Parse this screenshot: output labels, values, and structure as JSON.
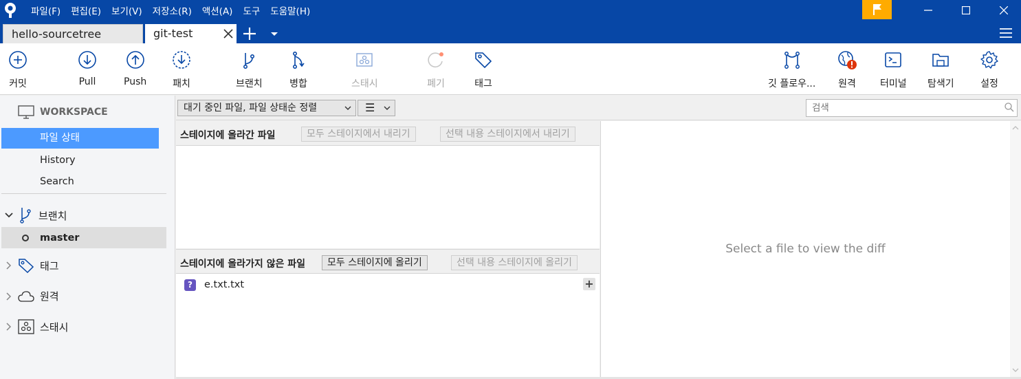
{
  "menu": [
    "파일(F)",
    "편집(E)",
    "보기(V)",
    "저장소(R)",
    "액션(A)",
    "도구",
    "도움말(H)"
  ],
  "tabs": [
    {
      "label": "hello-sourcetree",
      "active": false
    },
    {
      "label": "git-test",
      "active": true
    }
  ],
  "toolbar": {
    "commit": "커밋",
    "pull": "Pull",
    "push": "Push",
    "patch": "패치",
    "branch": "브랜치",
    "merge": "병합",
    "stash": "스태시",
    "discard": "폐기",
    "tag": "태그",
    "gitflow": "깃 플로우...",
    "remote": "원격",
    "terminal": "터미널",
    "explorer": "탐색기",
    "settings": "설정"
  },
  "sidebar": {
    "workspace": "WORKSPACE",
    "items": [
      "파일 상태",
      "History",
      "Search"
    ],
    "branches_label": "브랜치",
    "current_branch": "master",
    "tags_label": "태그",
    "remotes_label": "원격",
    "stashes_label": "스태시"
  },
  "filter": {
    "sort": "대기 중인 파일, 파일 상태순 정렬",
    "view_icon": "☰",
    "search_placeholder": "검색"
  },
  "staged": {
    "title": "스테이지에 올라간 파일",
    "unstage_all": "모두 스테이지에서 내리기",
    "unstage_selected": "선택 내용 스테이지에서 내리기"
  },
  "unstaged": {
    "title": "스테이지에 올라가지 않은 파일",
    "stage_all": "모두 스테이지에 올리기",
    "stage_selected": "선택 내용 스테이지에 올리기",
    "files": [
      {
        "status_icon": "?",
        "name": "e.txt.txt"
      }
    ]
  },
  "diff": {
    "placeholder": "Select a file to view the diff"
  },
  "colors": {
    "titlebar": "#0747a6",
    "selected": "#4c9aff",
    "flag": "#ffab00",
    "untracked": "#6554c0",
    "alert": "#de350b"
  }
}
